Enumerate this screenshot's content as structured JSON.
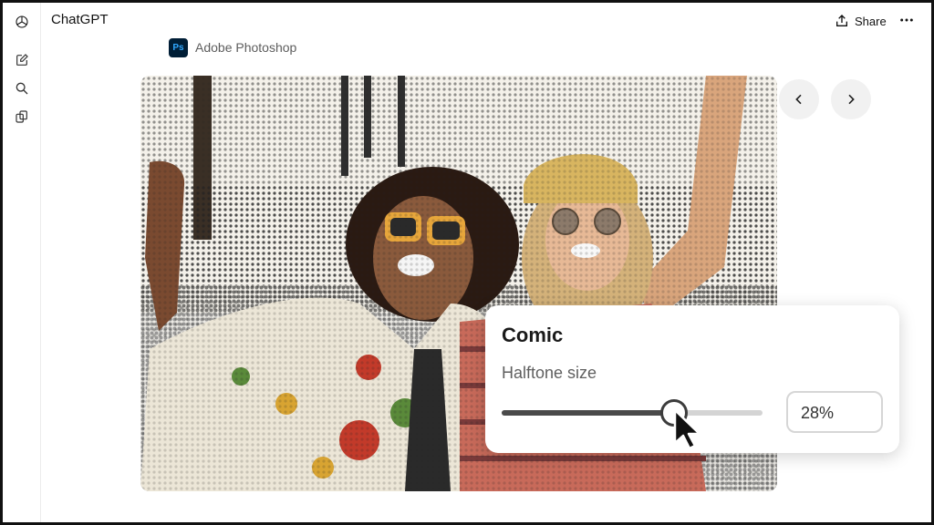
{
  "app": {
    "title": "ChatGPT",
    "share_label": "Share"
  },
  "sidebar": {
    "items": [
      {
        "icon": "new-chat-icon"
      },
      {
        "icon": "search-icon"
      },
      {
        "icon": "gpts-icon"
      }
    ]
  },
  "plugin": {
    "name": "Adobe Photoshop",
    "logo_text": "Ps"
  },
  "image_nav": {
    "prev_icon": "chevron-left-icon",
    "next_icon": "chevron-right-icon"
  },
  "effect_panel": {
    "title": "Comic",
    "setting_label": "Halftone size",
    "value_text": "28%",
    "slider_fraction": 0.66
  },
  "colors": {
    "ps_logo_bg": "#001e36",
    "ps_logo_text": "#31a8ff",
    "slider_fill": "#4a4a4a"
  }
}
